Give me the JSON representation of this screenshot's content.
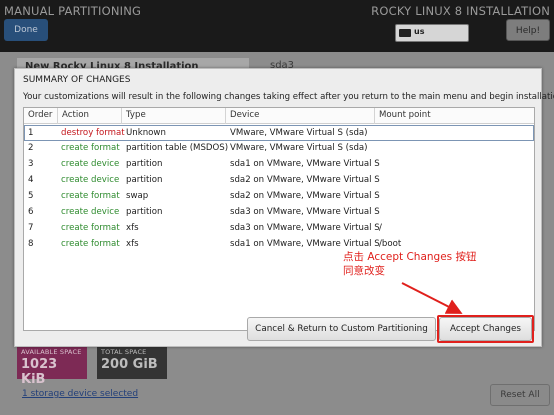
{
  "header": {
    "title": "MANUAL PARTITIONING",
    "product": "ROCKY LINUX 8 INSTALLATION",
    "done_label": "Done",
    "help_label": "Help!",
    "keyboard_layout": "us"
  },
  "background": {
    "tree_root": "New Rocky Linux 8 Installation",
    "device_name": "sda3",
    "available_space_label": "AVAILABLE SPACE",
    "available_space_value": "1023 KiB",
    "total_space_label": "TOTAL SPACE",
    "total_space_value": "200 GiB",
    "storage_link": "1 storage device selected",
    "reset_all_label": "Reset All"
  },
  "dialog": {
    "title": "SUMMARY OF CHANGES",
    "description": "Your customizations will result in the following changes taking effect after you return to the main menu and begin installation:",
    "columns": [
      "Order",
      "Action",
      "Type",
      "Device",
      "Mount point"
    ],
    "rows": [
      {
        "order": "1",
        "action": "destroy format",
        "type": "Unknown",
        "device": "VMware, VMware Virtual S (sda)",
        "mount": ""
      },
      {
        "order": "2",
        "action": "create format",
        "type": "partition table (MSDOS)",
        "device": "VMware, VMware Virtual S (sda)",
        "mount": ""
      },
      {
        "order": "3",
        "action": "create device",
        "type": "partition",
        "device": "sda1 on VMware, VMware Virtual S",
        "mount": ""
      },
      {
        "order": "4",
        "action": "create device",
        "type": "partition",
        "device": "sda2 on VMware, VMware Virtual S",
        "mount": ""
      },
      {
        "order": "5",
        "action": "create format",
        "type": "swap",
        "device": "sda2 on VMware, VMware Virtual S",
        "mount": ""
      },
      {
        "order": "6",
        "action": "create device",
        "type": "partition",
        "device": "sda3 on VMware, VMware Virtual S",
        "mount": ""
      },
      {
        "order": "7",
        "action": "create format",
        "type": "xfs",
        "device": "sda3 on VMware, VMware Virtual S",
        "mount": "/"
      },
      {
        "order": "8",
        "action": "create format",
        "type": "xfs",
        "device": "sda1 on VMware, VMware Virtual S",
        "mount": "/boot"
      }
    ],
    "cancel_label": "Cancel & Return to Custom Partitioning",
    "accept_label": "Accept Changes"
  },
  "annotation": {
    "line1": "点击 Accept Changes 按钮",
    "line2": "同意改变",
    "color": "#e0201c"
  },
  "colors": {
    "destroy": "#c4161c",
    "create": "#2e8b2e"
  }
}
